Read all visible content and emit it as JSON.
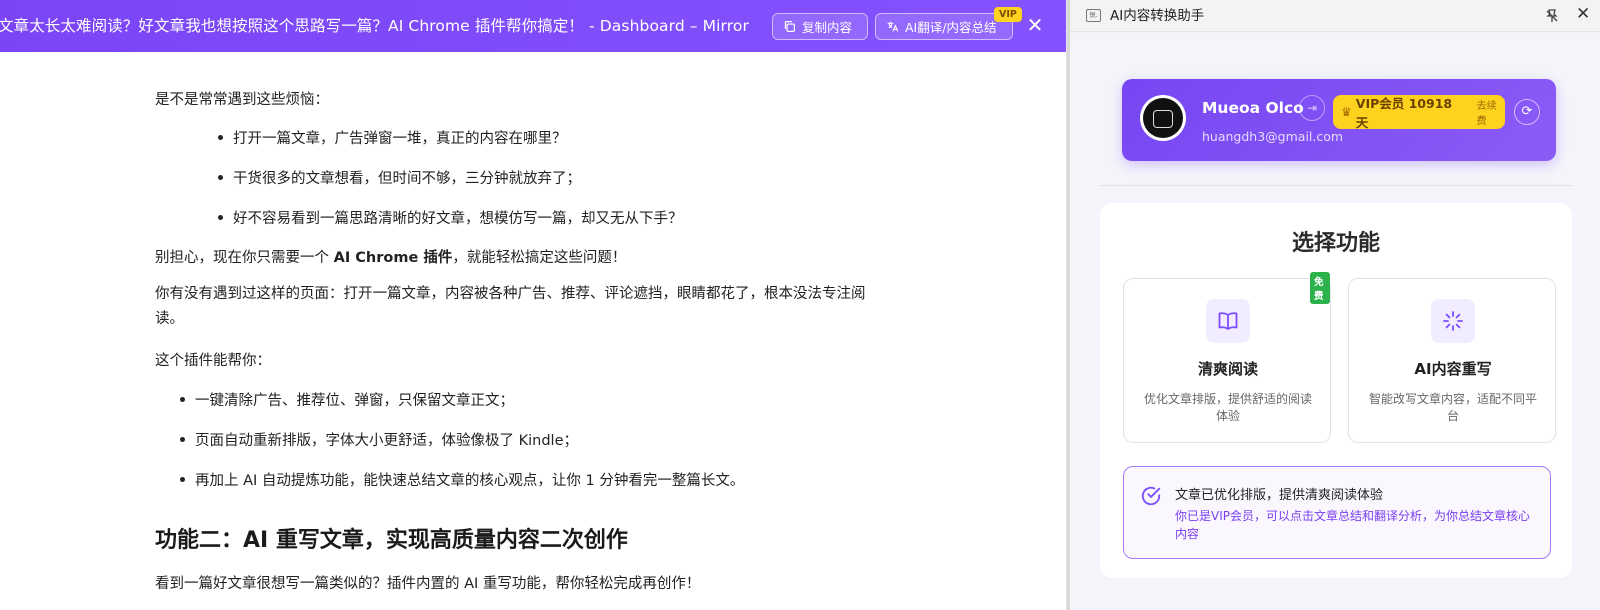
{
  "reader": {
    "topbar": {
      "title": "文章太长太难阅读？好文章我也想按照这个思路写一篇？AI Chrome 插件帮你搞定！ - Dashboard – Mirror",
      "copy_label": "复制内容",
      "ai_label": "AI翻译/内容总结",
      "vip_tag": "VIP",
      "close_glyph": "✕"
    },
    "article": {
      "p1": "是不是常常遇到这些烦恼：",
      "list1": [
        "打开一篇文章，广告弹窗一堆，真正的内容在哪里？",
        "干货很多的文章想看，但时间不够，三分钟就放弃了；",
        "好不容易看到一篇思路清晰的好文章，想模仿写一篇，却又无从下手？"
      ],
      "p2_before": "别担心，现在你只需要一个 ",
      "p2_bold": "AI Chrome 插件",
      "p2_after": "，就能轻松搞定这些问题！",
      "p3": "你有没有遇到过这样的页面：打开一篇文章，内容被各种广告、推荐、评论遮挡，眼睛都花了，根本没法专注阅读。",
      "p4": "这个插件能帮你：",
      "list2": [
        "一键清除广告、推荐位、弹窗，只保留文章正文；",
        "页面自动重新排版，字体大小更舒适，体验像极了 Kindle；",
        "再加上 AI 自动提炼功能，能快速总结文章的核心观点，让你 1 分钟看完一整篇长文。"
      ],
      "h2": "功能二：AI 重写文章，实现高质量内容二次创作",
      "p5": "看到一篇好文章很想写一篇类似的？插件内置的 AI 重写功能，帮你轻松完成再创作！"
    }
  },
  "panel": {
    "header": {
      "icon_text": "锐.",
      "title": "AI内容转换助手",
      "close_glyph": "✕"
    },
    "user": {
      "name": "Mueoa Olco",
      "email": "huangdh3@gmail.com",
      "vip_label": "VIP会员 10918天",
      "renew_label": "去续费"
    },
    "functions": {
      "title": "选择功能",
      "cards": [
        {
          "name": "清爽阅读",
          "desc": "优化文章排版，提供舒适的阅读体验",
          "badge": "免费",
          "icon": "book-icon"
        },
        {
          "name": "AI内容重写",
          "desc": "智能改写文章内容，适配不同平台",
          "icon": "loading-icon"
        }
      ],
      "status": {
        "title": "文章已优化排版，提供清爽阅读体验",
        "desc": "你已是VIP会员，可以点击文章总结和翻译分析，为你总结文章核心内容"
      }
    }
  },
  "colors": {
    "brand_purple": "#7c4dff",
    "vip_yellow": "#ffd21f",
    "free_green": "#2bb24c"
  }
}
